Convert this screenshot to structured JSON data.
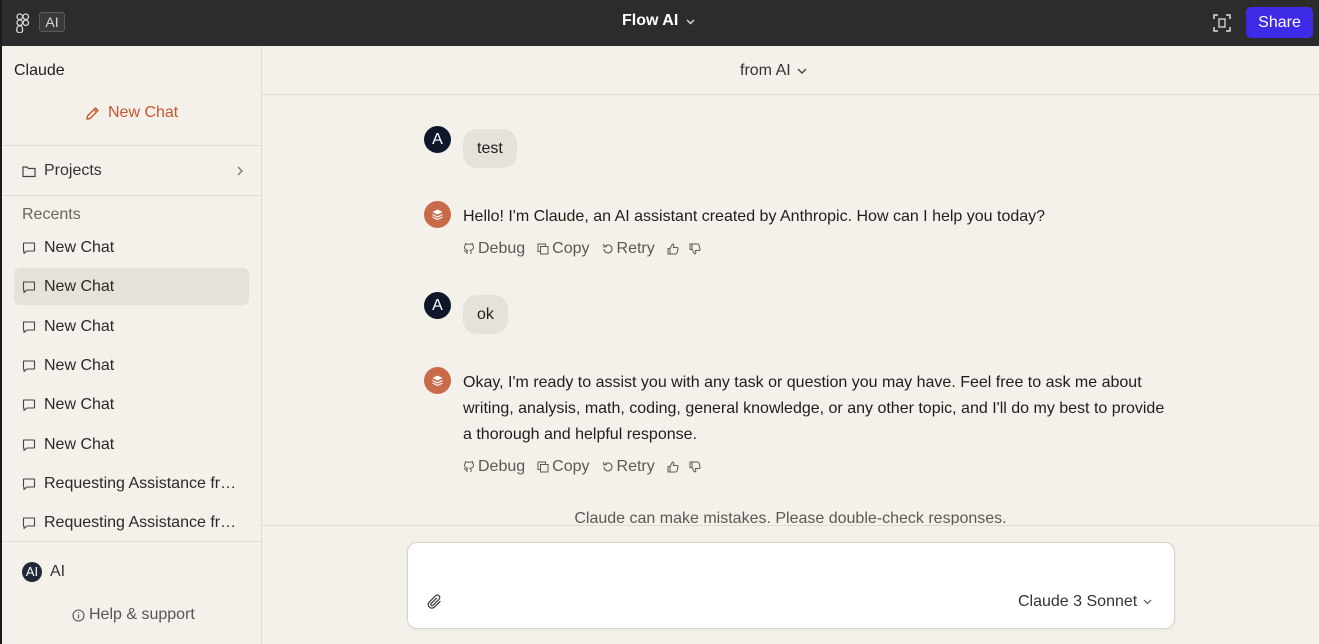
{
  "topbar": {
    "ai_badge": "AI",
    "title": "Flow AI",
    "share_label": "Share"
  },
  "sidebar": {
    "title": "Claude",
    "new_chat_label": "New Chat",
    "projects_label": "Projects",
    "recents_label": "Recents",
    "chats": [
      {
        "label": "New Chat",
        "active": false
      },
      {
        "label": "New Chat",
        "active": true
      },
      {
        "label": "New Chat",
        "active": false
      },
      {
        "label": "New Chat",
        "active": false
      },
      {
        "label": "New Chat",
        "active": false
      },
      {
        "label": "New Chat",
        "active": false
      },
      {
        "label": "Requesting Assistance fr…",
        "active": false
      },
      {
        "label": "Requesting Assistance fr…",
        "active": false
      }
    ],
    "user_initials": "AI",
    "user_name": "AI",
    "help_label": "Help & support"
  },
  "main": {
    "header_source": "from AI",
    "messages": [
      {
        "role": "user",
        "avatar": "A",
        "text": "test"
      },
      {
        "role": "assistant",
        "text": "Hello! I'm Claude, an AI assistant created by Anthropic. How can I help you today?"
      },
      {
        "role": "user",
        "avatar": "A",
        "text": "ok"
      },
      {
        "role": "assistant",
        "text": "Okay, I'm ready to assist you with any task or question you may have. Feel free to ask me about writing, analysis, math, coding, general knowledge, or any other topic, and I'll do my best to provide a thorough and helpful response."
      }
    ],
    "actions": {
      "debug": "Debug",
      "copy": "Copy",
      "retry": "Retry"
    },
    "disclaimer": "Claude can make mistakes. Please double-check responses."
  },
  "composer": {
    "value": "",
    "placeholder": "",
    "model": "Claude 3 Sonnet"
  },
  "colors": {
    "topbar_bg": "#2c2c2c",
    "share_bg": "#3d2be8",
    "accent": "#c4572f",
    "ai_avatar": "#c96a4a",
    "page_bg": "#f4f1ea"
  }
}
